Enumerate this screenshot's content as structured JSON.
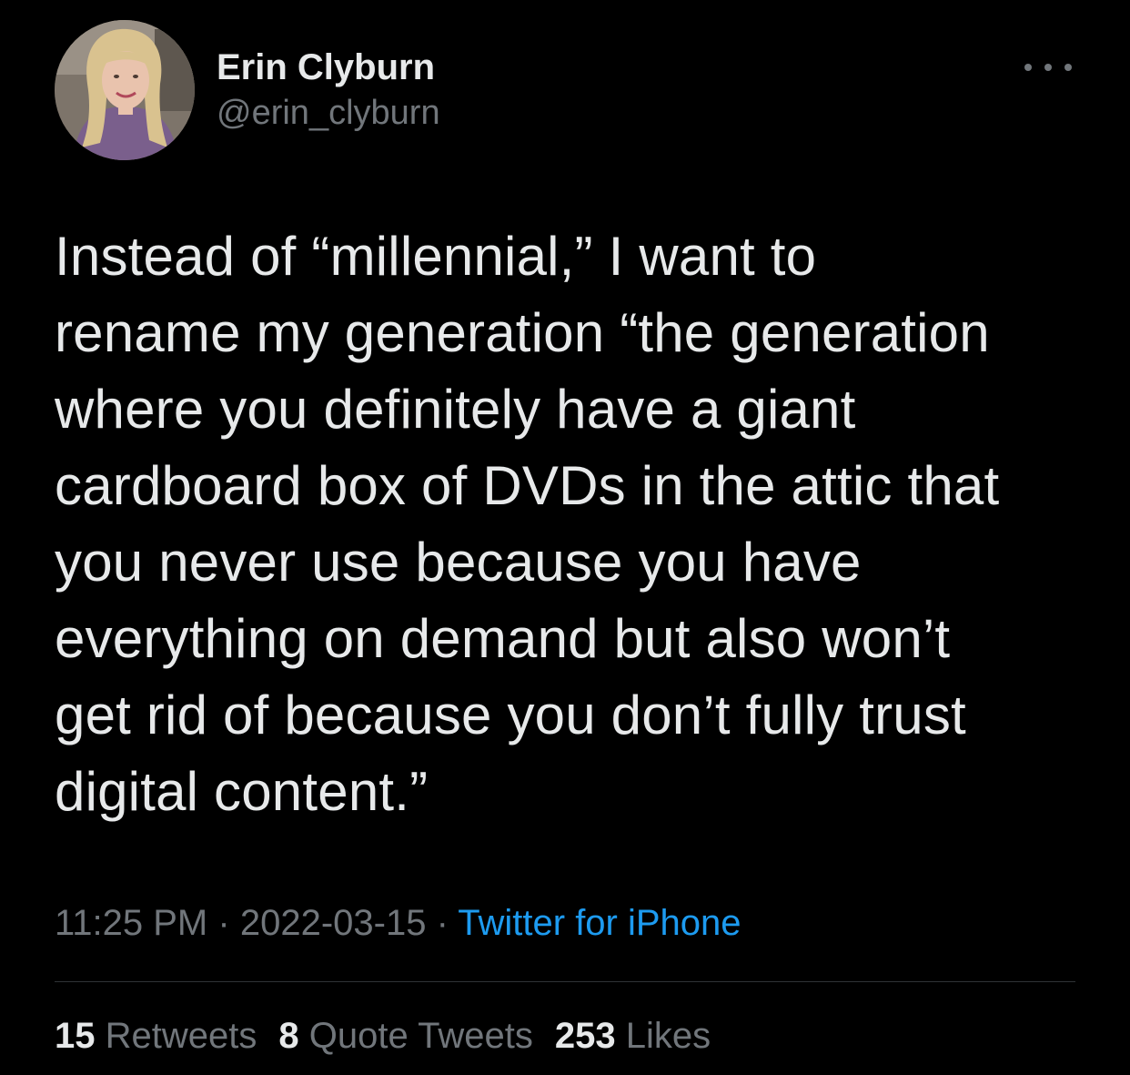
{
  "author": {
    "display_name": "Erin Clyburn",
    "handle": "@erin_clyburn"
  },
  "tweet": {
    "text_lines": [
      "Instead of “millennial,” I want to",
      "rename my generation “the generation",
      "where you definitely have a giant",
      "cardboard box of DVDs in the attic that",
      "you never use because you have",
      "everything on demand but also won’t",
      "get rid of because you don’t fully trust",
      "digital content.”"
    ],
    "time": "11:25 PM",
    "separator": "·",
    "date": "2022-03-15",
    "source": "Twitter for iPhone"
  },
  "stats": {
    "retweets_count": "15",
    "retweets_label": "Retweets",
    "quote_tweets_count": "8",
    "quote_tweets_label": "Quote Tweets",
    "likes_count": "253",
    "likes_label": "Likes"
  },
  "icons": {
    "more": "more-horizontal-icon"
  },
  "colors": {
    "background": "#000000",
    "primary_text": "#e7e9ea",
    "secondary_text": "#71767b",
    "link": "#1d9bf0",
    "divider": "#2f3336"
  }
}
